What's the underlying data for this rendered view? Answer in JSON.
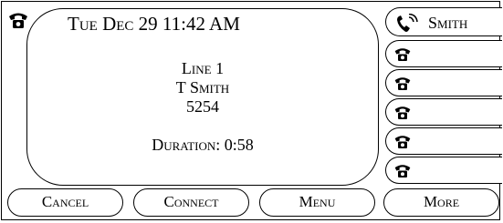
{
  "header": {
    "datetime": "Tue Dec 29 11:42 AM"
  },
  "call": {
    "line": "Line 1",
    "caller_name": "T Smith",
    "extension": "5254",
    "duration": "Duration: 0:58"
  },
  "line_buttons": [
    {
      "label": "Smith",
      "icon": "phone-ringing-icon"
    },
    {
      "label": "",
      "icon": "phone-icon"
    },
    {
      "label": "",
      "icon": "phone-icon"
    },
    {
      "label": "",
      "icon": "phone-icon"
    },
    {
      "label": "",
      "icon": "phone-icon"
    },
    {
      "label": "",
      "icon": "phone-icon"
    }
  ],
  "soft_keys": {
    "cancel": "Cancel",
    "connect": "Connect",
    "menu": "Menu",
    "more": "More"
  }
}
